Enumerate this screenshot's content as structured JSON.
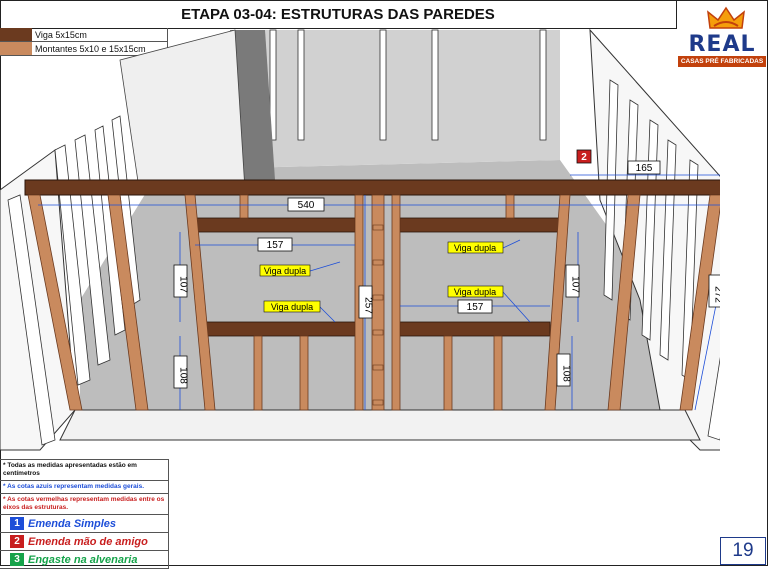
{
  "title": "ETAPA 03-04: ESTRUTURAS DAS PAREDES",
  "logo": {
    "brand": "REAL",
    "tagline": "CASAS PRÉ FABRICADAS"
  },
  "legend": [
    {
      "label": "Viga 5x15cm",
      "color": "#6b3a1f"
    },
    {
      "label": "Montantes 5x10 e 15x15cm",
      "color": "#c98a5e"
    }
  ],
  "dimensions": {
    "d540": "540",
    "d165": "165",
    "d157_top": "157",
    "d157_mid": "157",
    "d107_left": "107",
    "d108_left": "108",
    "d257": "257",
    "d107_right": "107",
    "d108_right": "108",
    "d272": "272",
    "marker2": "2"
  },
  "labels": {
    "viga_dupla_1": "Viga dupla",
    "viga_dupla_2": "Viga dupla",
    "viga_dupla_3": "Viga dupla",
    "viga_dupla_4": "Viga dupla"
  },
  "notes": {
    "n1": "* Todas as medidas apresentadas estão em centímetros",
    "n2": "* As cotas azuis representam medidas gerais.",
    "n3": "* As cotas vermelhas representam medidas entre os eixos das estruturas."
  },
  "items": [
    {
      "num": "1",
      "label": "Emenda Simples",
      "color": "#1d4ed8"
    },
    {
      "num": "2",
      "label": "Emenda mão de amigo",
      "color": "#c81e1e"
    },
    {
      "num": "3",
      "label": "Engaste na alvenaria",
      "color": "#16a34a"
    }
  ],
  "page_number": "19"
}
